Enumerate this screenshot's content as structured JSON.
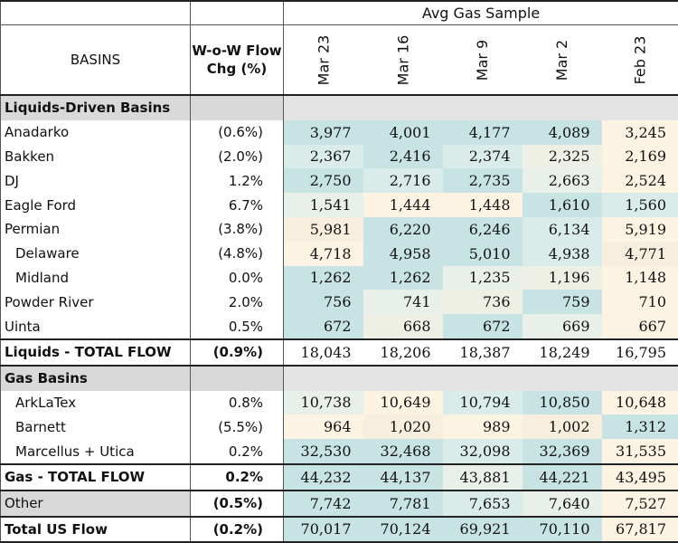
{
  "header": {
    "sample_title": "Avg Gas Sample",
    "basins_label": "BASINS",
    "chg_label_line1": "W-o-W Flow",
    "chg_label_line2": "Chg (%)",
    "dates": [
      "Mar 23",
      "Mar 16",
      "Mar 9",
      "Mar 2",
      "Feb 23"
    ]
  },
  "sections": {
    "liquids": "Liquids-Driven Basins",
    "gas": "Gas Basins"
  },
  "rows": {
    "anadarko": {
      "name": "Anadarko",
      "chg": "(0.6%)",
      "v": [
        "3,977",
        "4,001",
        "4,177",
        "4,089",
        "3,245"
      ]
    },
    "bakken": {
      "name": "Bakken",
      "chg": "(2.0%)",
      "v": [
        "2,367",
        "2,416",
        "2,374",
        "2,325",
        "2,169"
      ]
    },
    "dj": {
      "name": "DJ",
      "chg": "1.2%",
      "v": [
        "2,750",
        "2,716",
        "2,735",
        "2,663",
        "2,524"
      ]
    },
    "eagleford": {
      "name": "Eagle Ford",
      "chg": "6.7%",
      "v": [
        "1,541",
        "1,444",
        "1,448",
        "1,610",
        "1,560"
      ]
    },
    "permian": {
      "name": "Permian",
      "chg": "(3.8%)",
      "v": [
        "5,981",
        "6,220",
        "6,246",
        "6,134",
        "5,919"
      ]
    },
    "delaware": {
      "name": "Delaware",
      "chg": "(4.8%)",
      "v": [
        "4,718",
        "4,958",
        "5,010",
        "4,938",
        "4,771"
      ]
    },
    "midland": {
      "name": "Midland",
      "chg": "0.0%",
      "v": [
        "1,262",
        "1,262",
        "1,235",
        "1,196",
        "1,148"
      ]
    },
    "powder": {
      "name": "Powder River",
      "chg": "2.0%",
      "v": [
        "756",
        "741",
        "736",
        "759",
        "710"
      ]
    },
    "uinta": {
      "name": "Uinta",
      "chg": "0.5%",
      "v": [
        "672",
        "668",
        "672",
        "669",
        "667"
      ]
    },
    "liq_total": {
      "name": "Liquids - TOTAL FLOW",
      "chg": "(0.9%)",
      "v": [
        "18,043",
        "18,206",
        "18,387",
        "18,249",
        "16,795"
      ]
    },
    "arklatex": {
      "name": "ArkLaTex",
      "chg": "0.8%",
      "v": [
        "10,738",
        "10,649",
        "10,794",
        "10,850",
        "10,648"
      ]
    },
    "barnett": {
      "name": "Barnett",
      "chg": "(5.5%)",
      "v": [
        "964",
        "1,020",
        "989",
        "1,002",
        "1,312"
      ]
    },
    "marcellus": {
      "name": "Marcellus + Utica",
      "chg": "0.2%",
      "v": [
        "32,530",
        "32,468",
        "32,098",
        "32,369",
        "31,535"
      ]
    },
    "gas_total": {
      "name": "Gas - TOTAL FLOW",
      "chg": "0.2%",
      "v": [
        "44,232",
        "44,137",
        "43,881",
        "44,221",
        "43,495"
      ]
    },
    "other": {
      "name": "Other",
      "chg": "(0.5%)",
      "v": [
        "7,742",
        "7,781",
        "7,653",
        "7,640",
        "7,527"
      ]
    },
    "us_total": {
      "name": "Total US Flow",
      "chg": "(0.2%)",
      "v": [
        "70,017",
        "70,124",
        "69,921",
        "70,110",
        "67,817"
      ]
    }
  },
  "colors": {
    "heat_high": "#c7e3e3",
    "heat_midhigh": "#d9ecea",
    "heat_mid": "#e9f0ea",
    "heat_low": "#fdf3e3",
    "section_gray": "#d9d9d9"
  }
}
